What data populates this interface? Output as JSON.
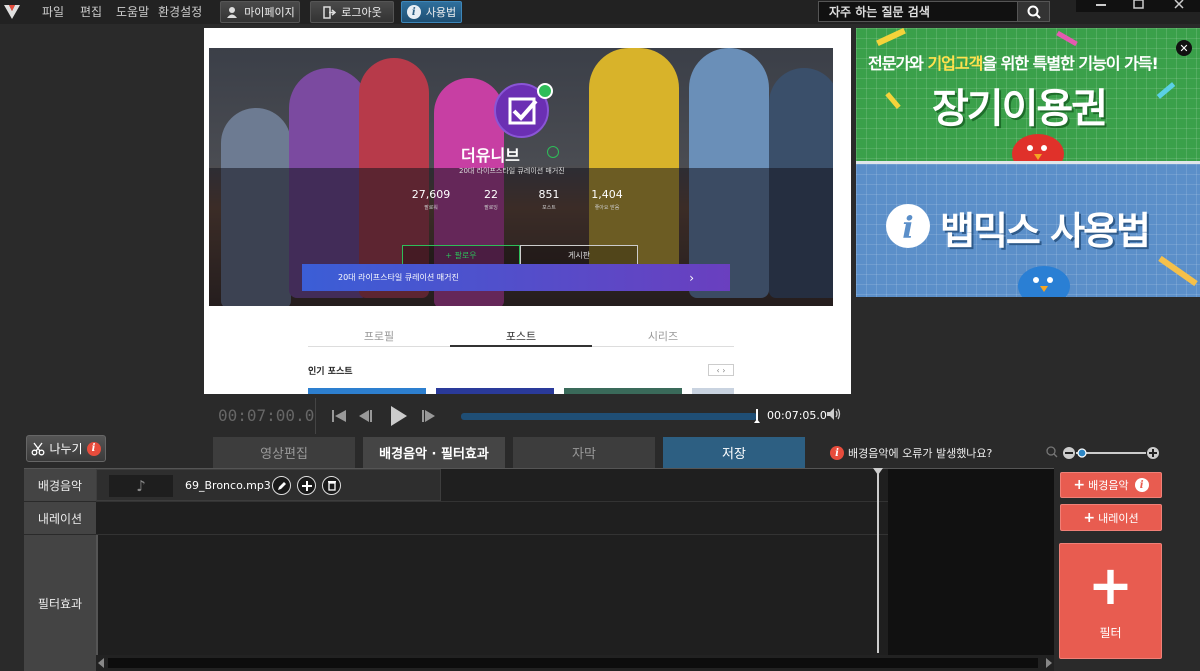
{
  "menu": {
    "file": "파일",
    "edit": "편집",
    "help": "도움말",
    "settings": "환경설정"
  },
  "toolbar": {
    "mypage": "마이페이지",
    "logout": "로그아웃",
    "howto": "사용법"
  },
  "search": {
    "placeholder": "자주 하는 질문 검색"
  },
  "preview": {
    "channel_name": "더유니브",
    "channel_desc": "20대 라이프스타일 큐레이션 매거진",
    "stats": [
      {
        "value": "27,609",
        "label": "팔로워"
      },
      {
        "value": "22",
        "label": "팔로잉"
      },
      {
        "value": "851",
        "label": "포스트"
      },
      {
        "value": "1,404",
        "label": "좋아요 받음"
      }
    ],
    "follow": "+ 팔로우",
    "board": "게시판",
    "banner": "20대 라이프스타일 큐레이션 매거진",
    "tabs": [
      "프로필",
      "포스트",
      "시리즈"
    ],
    "popular": "인기 포스트"
  },
  "ads": {
    "ad1_sub_a": "전문가와 ",
    "ad1_sub_b": "기업고객",
    "ad1_sub_c": "을 위한 특별한 기능이 가득!",
    "ad1_title": "장기이용권",
    "ad2_title": "뱁믹스 사용법"
  },
  "player": {
    "current": "00:07:00.0",
    "end": "00:07:05.0",
    "progress": 1.0
  },
  "split_label": "나누기",
  "tabs": {
    "video_edit": "영상편집",
    "bgm_filter": "배경음악 · 필터효과",
    "subtitle": "자막",
    "save": "저장"
  },
  "warning": "배경음악에 오류가 발생했나요?",
  "tracks": {
    "bgm": "배경음악",
    "narration": "내레이션",
    "filter": "필터효과"
  },
  "clip": {
    "name": "69_Bronco.mp3"
  },
  "buttons": {
    "add_bgm": "배경음악",
    "add_narration": "내레이션",
    "add_filter": "필터"
  },
  "colors": {
    "accent_red": "#e85c50",
    "tab_save": "#2d5f82",
    "seek": "#1f4e75"
  }
}
